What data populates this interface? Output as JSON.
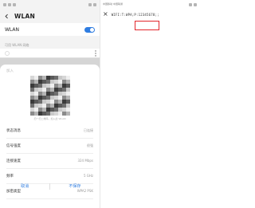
{
  "left": {
    "app_title": "WLAN",
    "wlan_label": "WLAN",
    "available_label": "可用 WLAN 网络",
    "dialog": {
      "title": "加入",
      "qr_caption": "扫一扫二维码，加入此 WLAN",
      "rows": [
        {
          "label": "状态消息",
          "value": "已连接"
        },
        {
          "label": "信号强度",
          "value": "很强"
        },
        {
          "label": "连接速度",
          "value": "324 Mbps"
        },
        {
          "label": "频率",
          "value": "5 GHz"
        },
        {
          "label": "加密类型",
          "value": "WPA2 PSK"
        }
      ],
      "cancel_label": "取消",
      "forget_label": "不保存"
    }
  },
  "right": {
    "carrier": "中国移动 中国联通",
    "scan_text": "WIFI:T:WPA;P:12345678;;",
    "close_glyph": "×"
  },
  "colors": {
    "accent": "#2f7de1",
    "highlight": "#e2262c"
  }
}
